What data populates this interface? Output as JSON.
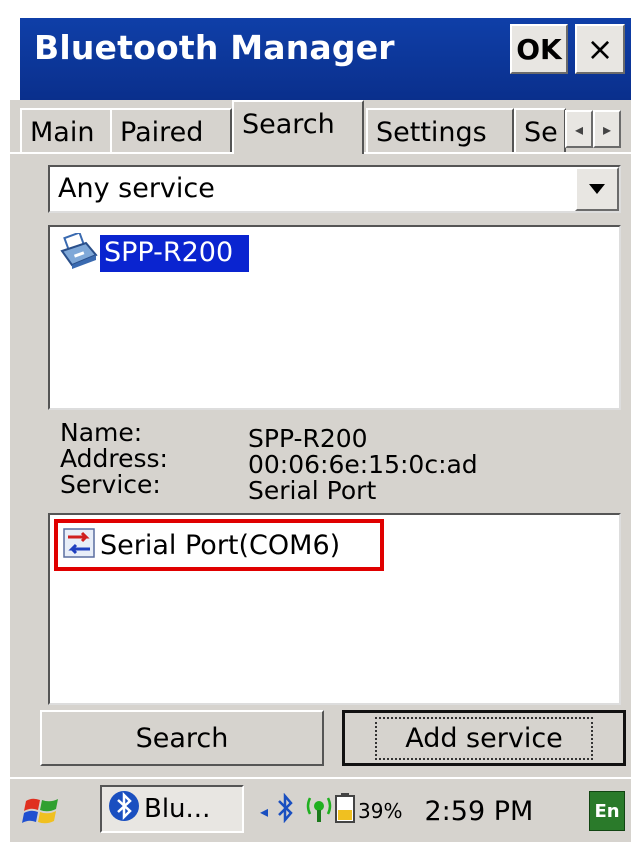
{
  "window": {
    "title": "Bluetooth Manager",
    "ok_label": "OK",
    "close_label": "×"
  },
  "tabs": [
    {
      "label": "Main"
    },
    {
      "label": "Paired"
    },
    {
      "label": "Search",
      "active": true
    },
    {
      "label": "Settings"
    },
    {
      "label": "Se"
    }
  ],
  "tab_scroll": {
    "left": "◂",
    "right": "▸"
  },
  "service_filter": {
    "selected": "Any service",
    "arrow": "▼"
  },
  "devices": [
    {
      "name": "SPP-R200",
      "icon": "printer-icon",
      "selected": true
    }
  ],
  "info": {
    "name_label": "Name:",
    "name_value": "SPP-R200",
    "address_label": "Address:",
    "address_value": "00:06:6e:15:0c:ad",
    "service_label": "Service:",
    "service_value": "Serial Port"
  },
  "services": [
    {
      "label": "Serial Port(COM6)",
      "icon": "serial-port-icon",
      "highlighted": true,
      "highlight_color": "#e00000"
    }
  ],
  "buttons": {
    "search": "Search",
    "add_service": "Add service"
  },
  "taskbar": {
    "task_label": "Blu...",
    "battery": "39%",
    "clock": "2:59 PM",
    "language": "En"
  },
  "colors": {
    "title_bar": "#0f3fa8",
    "selection": "#0a24d0"
  }
}
